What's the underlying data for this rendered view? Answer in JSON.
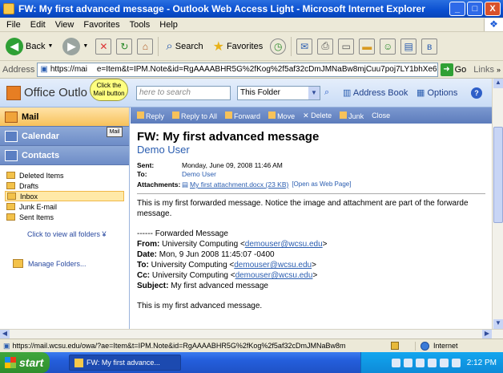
{
  "window": {
    "title": "FW: My first advanced message - Outlook Web Access Light - Microsoft Internet Explorer",
    "minimize": "_",
    "maximize": "□",
    "close": "X"
  },
  "menu": [
    "File",
    "Edit",
    "View",
    "Favorites",
    "Tools",
    "Help"
  ],
  "toolbar": {
    "back": "Back",
    "search": "Search",
    "favorites": "Favorites"
  },
  "address": {
    "label": "Address",
    "url_left": "https://mai",
    "url_right": "e=Item&t=IPM.Note&id=RgAAAABHR5G%2fKog%2f5af32cDmJMNaBw8mjCuu7poj7LY1bhXe6",
    "go": "Go",
    "links": "Links"
  },
  "owa": {
    "logo": "Office Outlo",
    "search_placeholder": "here to search",
    "folder_scope": "This Folder",
    "address_book": "Address Book",
    "options": "Options",
    "help": "?"
  },
  "callout": {
    "text": "Click the Mail button"
  },
  "nav": {
    "mail": "Mail",
    "calendar": "Calendar",
    "contacts": "Contacts",
    "mail_tag": "Mail",
    "folders": [
      {
        "label": "Deleted Items",
        "selected": false
      },
      {
        "label": "Drafts",
        "selected": false
      },
      {
        "label": "Inbox",
        "selected": true
      },
      {
        "label": "Junk E-mail",
        "selected": false
      },
      {
        "label": "Sent Items",
        "selected": false
      }
    ],
    "view_all": "Click to view all folders",
    "manage": "Manage Folders..."
  },
  "msg_toolbar": {
    "reply": "Reply",
    "reply_all": "Reply to All",
    "forward": "Forward",
    "move": "Move",
    "delete": "Delete",
    "junk": "Junk",
    "close": "Close"
  },
  "message": {
    "subject": "FW: My first advanced message",
    "sender": "Demo User",
    "sent_label": "Sent:",
    "sent": "Monday, June 09, 2008 11:46 AM",
    "to_label": "To:",
    "to": "Demo User",
    "attach_label": "Attachments:",
    "attachment": "My first attachment.docx (23 KB)",
    "open_web": "[Open as Web Page]",
    "body1": "This is my first forwarded message.  Notice the image and attachment are part of the forwarde",
    "body2": "message.",
    "fw_header": "------ Forwarded Message",
    "from_label": "From:",
    "from_name": "University Computing <",
    "from_email": "demouser@wcsu.edu",
    "date_label": "Date:",
    "date": "Mon, 9 Jun 2008 11:45:07 -0400",
    "to2_label": "To:",
    "to2_email": "demouser@wcsu.edu",
    "cc_label": "Cc:",
    "cc_email": "demouser@wcsu.edu",
    "subject2_label": "Subject:",
    "subject2": "My first advanced message",
    "body3": "This is my first advanced message."
  },
  "status": {
    "url": "https://mail.wcsu.edu/owa/?ae=Item&t=IPM.Note&id=RgAAAABHR5G%2fKog%2f5af32cDmJMNaBw8m",
    "zone": "Internet"
  },
  "taskbar": {
    "start": "start",
    "task": "FW: My first advance...",
    "time": "2:12 PM"
  }
}
